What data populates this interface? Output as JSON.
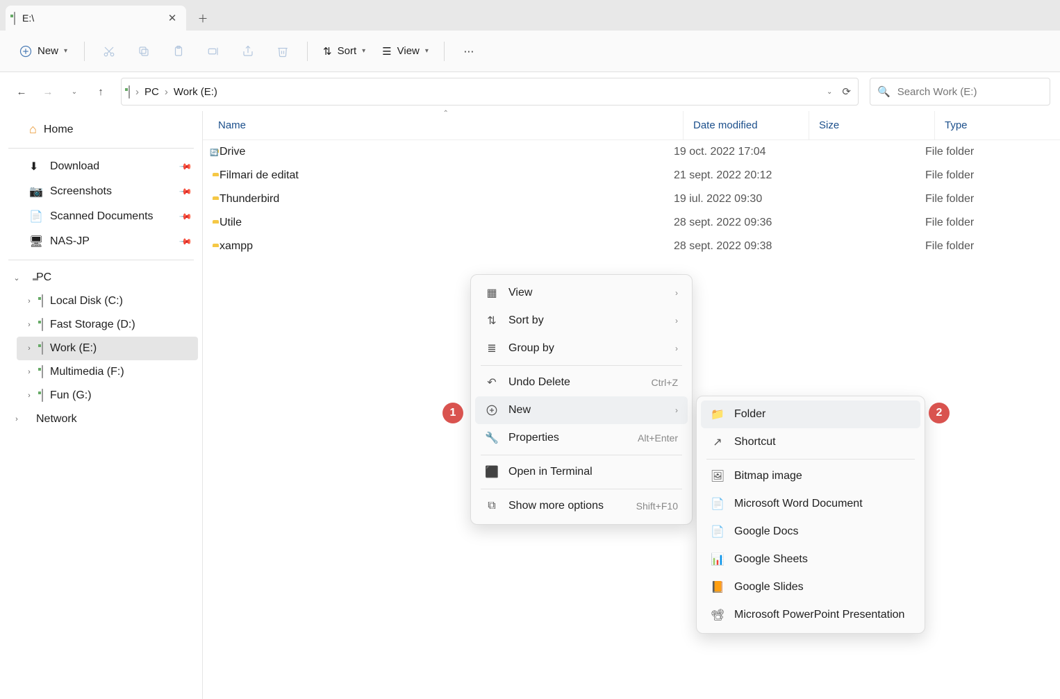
{
  "tab": {
    "title": "E:\\"
  },
  "toolbar": {
    "new_label": "New",
    "sort_label": "Sort",
    "view_label": "View"
  },
  "breadcrumbs": [
    "PC",
    "Work (E:)"
  ],
  "search": {
    "placeholder": "Search Work (E:)"
  },
  "sidebar": {
    "home": "Home",
    "quick": [
      "Download",
      "Screenshots",
      "Scanned Documents",
      "NAS-JP"
    ],
    "pc_label": "PC",
    "drives": [
      "Local Disk (C:)",
      "Fast Storage (D:)",
      "Work (E:)",
      "Multimedia (F:)",
      "Fun (G:)"
    ],
    "selected_drive_index": 2,
    "network": "Network"
  },
  "columns": {
    "name": "Name",
    "date": "Date modified",
    "size": "Size",
    "type": "Type"
  },
  "files": [
    {
      "name": "Drive",
      "date": "19 oct. 2022 17:04",
      "type": "File folder",
      "special": "drive-sync"
    },
    {
      "name": "Filmari de editat",
      "date": "21 sept. 2022 20:12",
      "type": "File folder"
    },
    {
      "name": "Thunderbird",
      "date": "19 iul. 2022 09:30",
      "type": "File folder"
    },
    {
      "name": "Utile",
      "date": "28 sept. 2022 09:36",
      "type": "File folder"
    },
    {
      "name": "xampp",
      "date": "28 sept. 2022 09:38",
      "type": "File folder"
    }
  ],
  "context_menu": {
    "view": "View",
    "sort_by": "Sort by",
    "group_by": "Group by",
    "undo_delete": "Undo Delete",
    "undo_shortcut": "Ctrl+Z",
    "new": "New",
    "properties": "Properties",
    "properties_shortcut": "Alt+Enter",
    "open_terminal": "Open in Terminal",
    "show_more": "Show more options",
    "show_more_shortcut": "Shift+F10"
  },
  "submenu": [
    "Folder",
    "Shortcut",
    "Bitmap image",
    "Microsoft Word Document",
    "Google Docs",
    "Google Sheets",
    "Google Slides",
    "Microsoft PowerPoint Presentation"
  ],
  "badges": {
    "one": "1",
    "two": "2"
  }
}
